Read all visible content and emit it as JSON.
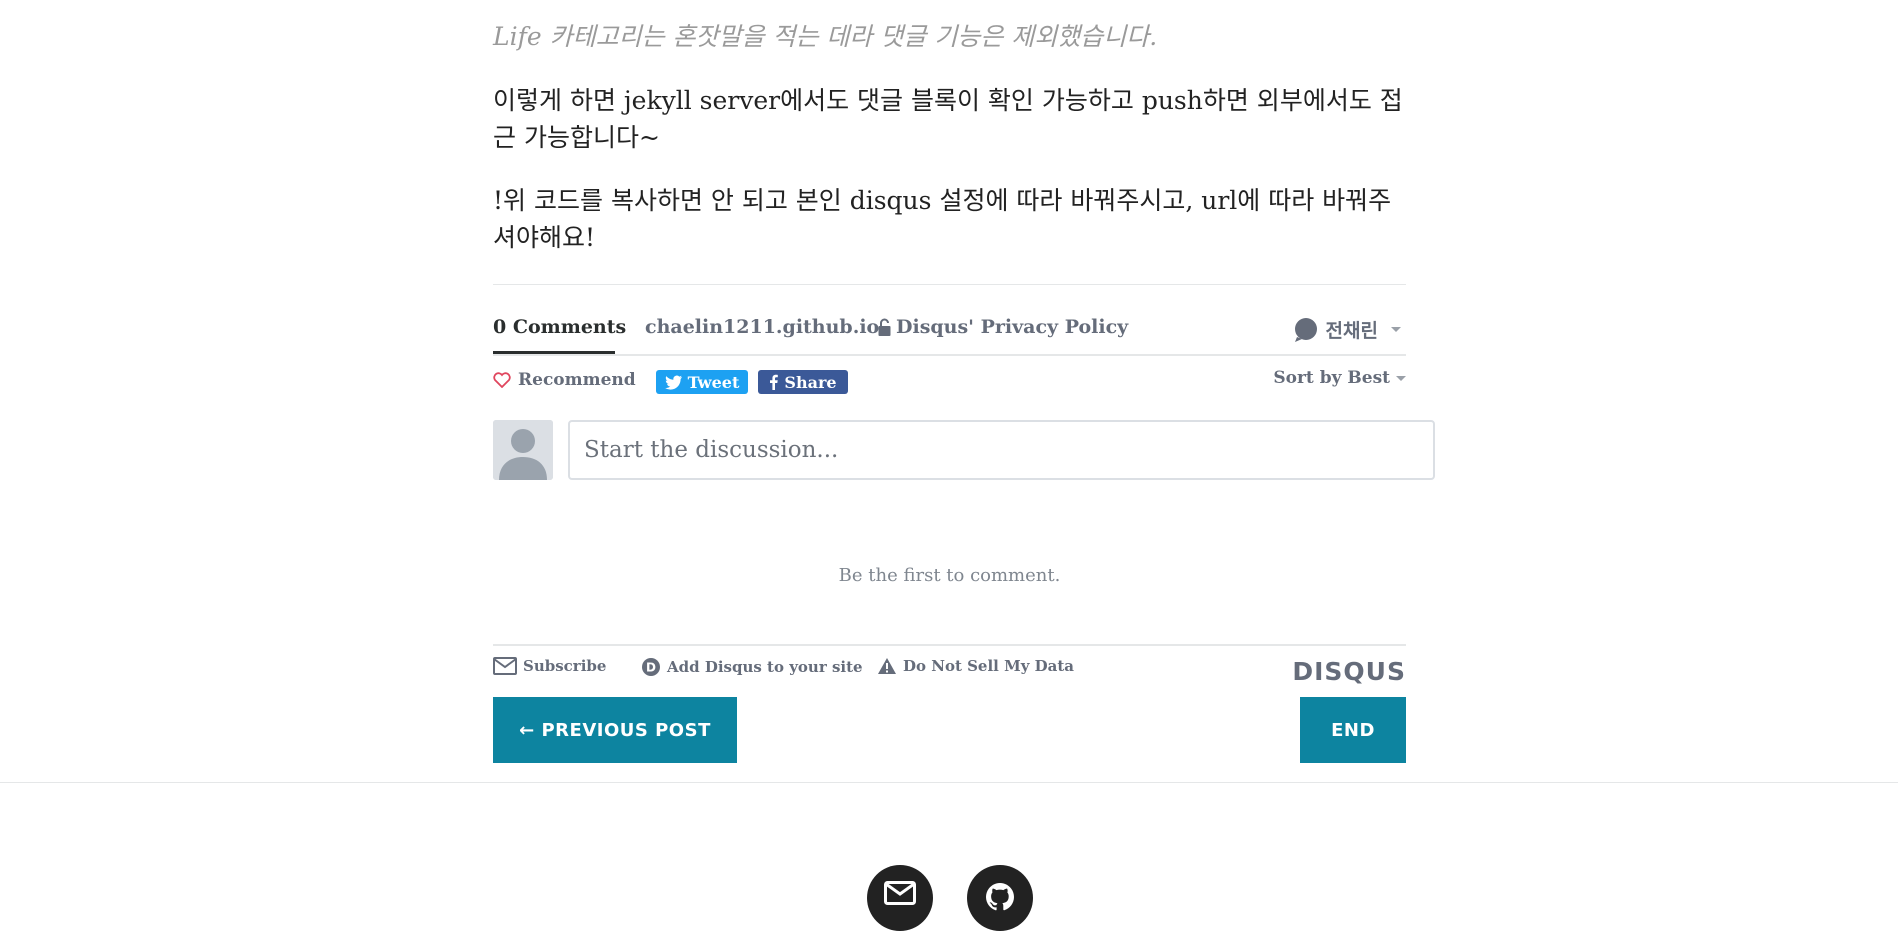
{
  "post": {
    "italic_note": "Life 카테고리는 혼잣말을 적는 데라 댓글 기능은 제외했습니다.",
    "paragraph_1": "이렇게 하면 jekyll server에서도 댓글 블록이 확인 가능하고 push하면 외부에서도 접근 가능합니다~",
    "paragraph_2": "!위 코드를 복사하면 안 되고 본인 disqus 설정에 따라 바꿔주시고, url에 따라 바꿔주셔야해요!"
  },
  "disqus": {
    "nav": {
      "comments_count": "0 Comments",
      "domain": "chaelin1211.github.io",
      "privacy": "Disqus' Privacy Policy",
      "username": "전채린"
    },
    "actions": {
      "recommend": "Recommend",
      "tweet": "Tweet",
      "share": "Share",
      "sort": "Sort by Best"
    },
    "composer": {
      "placeholder": "Start the discussion..."
    },
    "empty_state": "Be the first to comment.",
    "footer": {
      "subscribe": "Subscribe",
      "add_disqus": "Add Disqus to your site",
      "do_not_sell": "Do Not Sell My Data",
      "logo": "DISQUS"
    }
  },
  "pager": {
    "previous": "← PREVIOUS POST",
    "next": "END"
  },
  "social": {
    "icons": [
      "mail-icon",
      "github-icon"
    ]
  },
  "colors": {
    "accent": "#0d84a0",
    "twitter": "#1da1f2",
    "facebook": "#3b5998",
    "muted": "#656c7a"
  }
}
